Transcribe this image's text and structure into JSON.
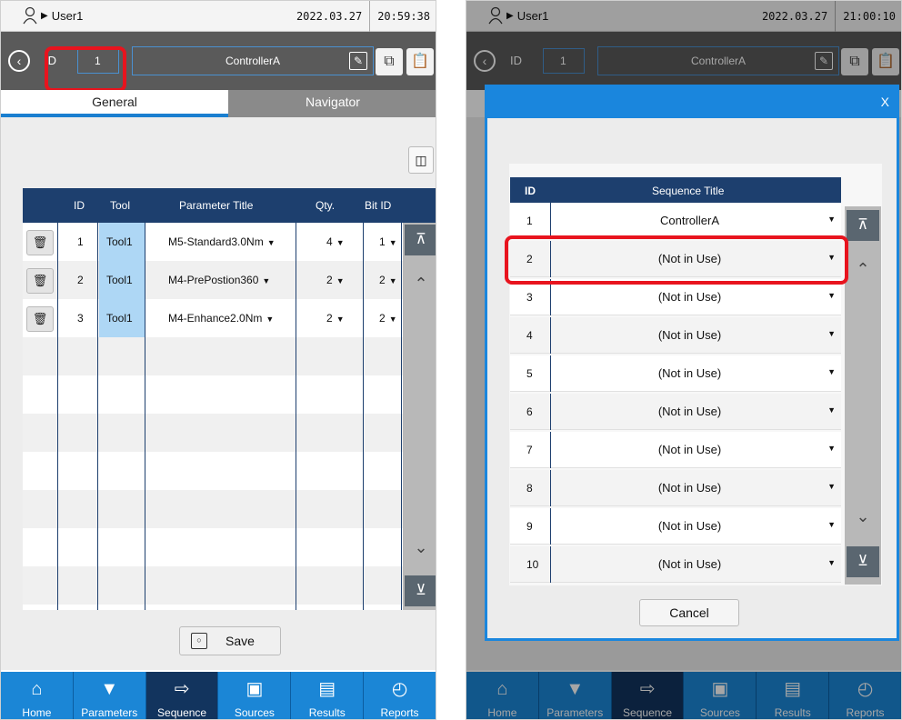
{
  "left": {
    "status": {
      "user": "User1",
      "date": "2022.03.27",
      "time": "20:59:38"
    },
    "header": {
      "id_label": "ID",
      "id_value": "1",
      "controller": "ControllerA"
    },
    "tabs": [
      "General",
      "Navigator"
    ],
    "table": {
      "headers": [
        "ID",
        "Tool",
        "Parameter Title",
        "Qty.",
        "Bit ID"
      ],
      "rows": [
        {
          "id": "1",
          "tool": "Tool1",
          "title": "M5-Standard3.0Nm",
          "qty": "4",
          "bit": "1"
        },
        {
          "id": "2",
          "tool": "Tool1",
          "title": "M4-PrePostion360",
          "qty": "2",
          "bit": "2"
        },
        {
          "id": "3",
          "tool": "Tool1",
          "title": "M4-Enhance2.0Nm",
          "qty": "2",
          "bit": "2"
        }
      ]
    },
    "save_label": "Save"
  },
  "right": {
    "status": {
      "user": "User1",
      "date": "2022.03.27",
      "time": "21:00:10"
    },
    "header": {
      "id_label": "ID",
      "id_value": "1",
      "controller": "ControllerA"
    },
    "modal": {
      "close": "X",
      "headers": [
        "ID",
        "Sequence Title"
      ],
      "rows": [
        {
          "id": "1",
          "title": "ControllerA"
        },
        {
          "id": "2",
          "title": "(Not in Use)"
        },
        {
          "id": "3",
          "title": "(Not in Use)"
        },
        {
          "id": "4",
          "title": "(Not in Use)"
        },
        {
          "id": "5",
          "title": "(Not in Use)"
        },
        {
          "id": "6",
          "title": "(Not in Use)"
        },
        {
          "id": "7",
          "title": "(Not in Use)"
        },
        {
          "id": "8",
          "title": "(Not in Use)"
        },
        {
          "id": "9",
          "title": "(Not in Use)"
        },
        {
          "id": "10",
          "title": "(Not in Use)"
        }
      ],
      "cancel": "Cancel"
    }
  },
  "nav": [
    {
      "label": "Home",
      "icon": "home-icon"
    },
    {
      "label": "Parameters",
      "icon": "screw-icon"
    },
    {
      "label": "Sequence",
      "icon": "sequence-icon"
    },
    {
      "label": "Sources",
      "icon": "sources-icon"
    },
    {
      "label": "Results",
      "icon": "results-icon"
    },
    {
      "label": "Reports",
      "icon": "reports-icon"
    }
  ],
  "colors": {
    "nav_blue": "#1b86d6",
    "nav_active": "#12345e",
    "table_header": "#1d3f6e",
    "highlight": "#e8141e",
    "header_gray": "#5a5a5a"
  }
}
